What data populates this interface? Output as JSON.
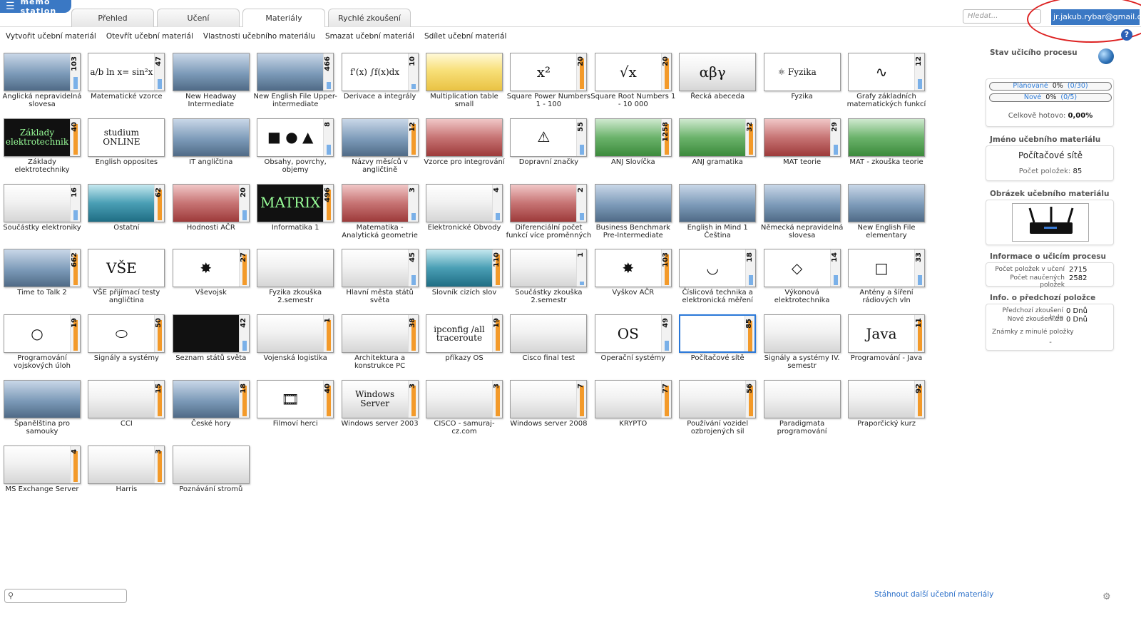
{
  "app": {
    "brand": "memo station",
    "menu_icon": "☰"
  },
  "tabs": [
    "Přehled",
    "Učení",
    "Materiály",
    "Rychlé zkoušení"
  ],
  "active_tab": 2,
  "search": {
    "placeholder": "Hledat..."
  },
  "user": {
    "email": "jr.jakub.rybar@gmail.com"
  },
  "window_controls": "–   ❐   ✕",
  "toolbar": [
    "Vytvořit učební materiál",
    "Otevřít učební materiál",
    "Vlastnosti učebního materiálu",
    "Smazat učební materiál",
    "Sdílet učební materiál"
  ],
  "help": "?",
  "materials": [
    {
      "label": "Anglická nepravidelná slovesa",
      "count": "103",
      "style": "photo",
      "glyph": "",
      "fill": "blue",
      "level": 0.35
    },
    {
      "label": "Matematické vzorce",
      "count": "47",
      "style": "white",
      "glyph": "a/b ln x= sin²x",
      "fill": "blue",
      "level": 0.3
    },
    {
      "label": "New Headway Intermediate",
      "count": "",
      "style": "photo",
      "glyph": "",
      "fill": "",
      "level": 0
    },
    {
      "label": "New English File Upper-intermediate",
      "count": "466",
      "style": "photo",
      "glyph": "",
      "fill": "blue",
      "level": 0.2
    },
    {
      "label": "Derivace a integrály",
      "count": "10",
      "style": "white",
      "glyph": "f'(x) ∫f(x)dx",
      "fill": "blue",
      "level": 0.15
    },
    {
      "label": "Multiplication table small",
      "count": "",
      "style": "yellow",
      "glyph": "",
      "fill": "",
      "level": 0
    },
    {
      "label": "Square Power Numbers 1 - 100",
      "count": "20",
      "style": "white",
      "glyph": "x²",
      "fill": "orange",
      "level": 0.9
    },
    {
      "label": "Square Root Numbers 1 - 10 000",
      "count": "20",
      "style": "white",
      "glyph": "√x",
      "fill": "orange",
      "level": 0.9
    },
    {
      "label": "Řecká abeceda",
      "count": "",
      "style": "gray",
      "glyph": "αβγ",
      "fill": "",
      "level": 0
    },
    {
      "label": "Fyzika",
      "count": "",
      "style": "white",
      "glyph": "⚛ Fyzika",
      "fill": "",
      "level": 0
    },
    {
      "label": "Grafy základních matematických funkcí",
      "count": "12",
      "style": "white",
      "glyph": "∿",
      "fill": "blue",
      "level": 0.3
    },
    {
      "label": "Základy elektrotechniky",
      "count": "40",
      "style": "dark",
      "glyph": "Základy elektrotechnik",
      "fill": "orange",
      "level": 0.9
    },
    {
      "label": "English opposites",
      "count": "",
      "style": "white",
      "glyph": "studium ONLINE",
      "fill": "",
      "level": 0
    },
    {
      "label": "IT angličtina",
      "count": "",
      "style": "photo",
      "glyph": "",
      "fill": "",
      "level": 0
    },
    {
      "label": "Obsahy, povrchy, objemy",
      "count": "8",
      "style": "white",
      "glyph": "■ ● ▲",
      "fill": "blue",
      "level": 0.3
    },
    {
      "label": "Názvy měsíců v angličtině",
      "count": "12",
      "style": "photo",
      "glyph": "",
      "fill": "orange",
      "level": 0.9
    },
    {
      "label": "Vzorce pro integrování",
      "count": "",
      "style": "red",
      "glyph": "",
      "fill": "",
      "level": 0
    },
    {
      "label": "Dopravní značky",
      "count": "55",
      "style": "white",
      "glyph": "⚠",
      "fill": "blue",
      "level": 0.3
    },
    {
      "label": "ANJ Slovíčka",
      "count": "1258",
      "style": "green",
      "glyph": "",
      "fill": "orange",
      "level": 0.9
    },
    {
      "label": "ANJ gramatika",
      "count": "32",
      "style": "green",
      "glyph": "",
      "fill": "orange",
      "level": 0.9
    },
    {
      "label": "MAT teorie",
      "count": "29",
      "style": "red",
      "glyph": "",
      "fill": "blue",
      "level": 0.3
    },
    {
      "label": "MAT - zkouška teorie",
      "count": "",
      "style": "green",
      "glyph": "",
      "fill": "",
      "level": 0
    },
    {
      "label": "Součástky elektroniky",
      "count": "16",
      "style": "gray",
      "glyph": "",
      "fill": "blue",
      "level": 0.3
    },
    {
      "label": "Ostatní",
      "count": "62",
      "style": "teal",
      "glyph": "",
      "fill": "orange",
      "level": 0.9
    },
    {
      "label": "Hodnosti AČR",
      "count": "20",
      "style": "red",
      "glyph": "",
      "fill": "blue",
      "level": 0.3
    },
    {
      "label": "Informatika 1",
      "count": "496",
      "style": "dark",
      "glyph": "MATRIX",
      "fill": "orange",
      "level": 0.9
    },
    {
      "label": "Matematika - Analytická geometrie",
      "count": "3",
      "style": "red",
      "glyph": "",
      "fill": "blue",
      "level": 0.2
    },
    {
      "label": "Elektronické Obvody",
      "count": "4",
      "style": "gray",
      "glyph": "",
      "fill": "blue",
      "level": 0.2
    },
    {
      "label": "Diferenciální počet funkcí více proměnných",
      "count": "2",
      "style": "red",
      "glyph": "",
      "fill": "blue",
      "level": 0.2
    },
    {
      "label": "Business Benchmark Pre-Intermediate",
      "count": "",
      "style": "photo",
      "glyph": "",
      "fill": "",
      "level": 0
    },
    {
      "label": "English in Mind 1 Čeština",
      "count": "",
      "style": "photo",
      "glyph": "",
      "fill": "",
      "level": 0
    },
    {
      "label": "Německá nepravidelná slovesa",
      "count": "",
      "style": "photo",
      "glyph": "",
      "fill": "",
      "level": 0
    },
    {
      "label": "New English File elementary",
      "count": "",
      "style": "photo",
      "glyph": "",
      "fill": "",
      "level": 0
    },
    {
      "label": "Time to Talk 2",
      "count": "662",
      "style": "photo",
      "glyph": "",
      "fill": "orange",
      "level": 0.9
    },
    {
      "label": "VŠE přijímací testy angličtina",
      "count": "",
      "style": "white",
      "glyph": "VŠE",
      "fill": "",
      "level": 0
    },
    {
      "label": "Vševojsk",
      "count": "27",
      "style": "white",
      "glyph": "✸",
      "fill": "orange",
      "level": 0.9
    },
    {
      "label": "Fyzika zkouška 2.semestr",
      "count": "",
      "style": "gray",
      "glyph": "",
      "fill": "",
      "level": 0
    },
    {
      "label": "Hlavní města států světa",
      "count": "45",
      "style": "gray",
      "glyph": "",
      "fill": "blue",
      "level": 0.3
    },
    {
      "label": "Slovník cizích slov",
      "count": "110",
      "style": "teal",
      "glyph": "",
      "fill": "orange",
      "level": 0.9
    },
    {
      "label": "Součástky zkouška 2.semestr",
      "count": "1",
      "style": "gray",
      "glyph": "",
      "fill": "blue",
      "level": 0.1
    },
    {
      "label": "Vyškov AČR",
      "count": "103",
      "style": "white",
      "glyph": "✸",
      "fill": "orange",
      "level": 0.9
    },
    {
      "label": "Číslicová technika a elektronická měření",
      "count": "18",
      "style": "white",
      "glyph": "◡",
      "fill": "blue",
      "level": 0.3
    },
    {
      "label": "Výkonová elektrotechnika",
      "count": "14",
      "style": "white",
      "glyph": "◇",
      "fill": "blue",
      "level": 0.3
    },
    {
      "label": "Antény a šíření rádiových vln",
      "count": "33",
      "style": "white",
      "glyph": "□",
      "fill": "blue",
      "level": 0.3
    },
    {
      "label": "Programování vojskových úloh",
      "count": "19",
      "style": "white",
      "glyph": "○",
      "fill": "orange",
      "level": 0.9
    },
    {
      "label": "Signály a systémy",
      "count": "50",
      "style": "white",
      "glyph": "⬭",
      "fill": "orange",
      "level": 0.9
    },
    {
      "label": "Seznam států světa",
      "count": "42",
      "style": "dark",
      "glyph": "",
      "fill": "blue",
      "level": 0.3
    },
    {
      "label": "Vojenská logistika",
      "count": "1",
      "style": "gray",
      "glyph": "",
      "fill": "orange",
      "level": 0.9
    },
    {
      "label": "Architektura a konstrukce PC",
      "count": "38",
      "style": "gray",
      "glyph": "",
      "fill": "orange",
      "level": 0.9
    },
    {
      "label": "příkazy OS",
      "count": "19",
      "style": "white",
      "glyph": "ipconfig /all traceroute",
      "fill": "orange",
      "level": 0.9
    },
    {
      "label": "Cisco final test",
      "count": "",
      "style": "gray",
      "glyph": "",
      "fill": "",
      "level": 0
    },
    {
      "label": "Operační systémy",
      "count": "49",
      "style": "white",
      "glyph": "OS",
      "fill": "blue",
      "level": 0.3
    },
    {
      "label": "Počítačové sítě",
      "count": "85",
      "style": "white",
      "glyph": "",
      "fill": "orange",
      "level": 0.9
    },
    {
      "label": "Signály a systémy IV. semestr",
      "count": "",
      "style": "gray",
      "glyph": "",
      "fill": "",
      "level": 0
    },
    {
      "label": "Programování - Java",
      "count": "11",
      "style": "white",
      "glyph": "Java",
      "fill": "orange",
      "level": 0.9
    },
    {
      "label": "Španělština pro samouky",
      "count": "",
      "style": "photo",
      "glyph": "",
      "fill": "",
      "level": 0
    },
    {
      "label": "CCI",
      "count": "15",
      "style": "gray",
      "glyph": "",
      "fill": "orange",
      "level": 0.9
    },
    {
      "label": "České hory",
      "count": "18",
      "style": "photo",
      "glyph": "",
      "fill": "orange",
      "level": 0.9
    },
    {
      "label": "Filmoví herci",
      "count": "40",
      "style": "white",
      "glyph": "🎞",
      "fill": "orange",
      "level": 0.9
    },
    {
      "label": "Windows server 2003",
      "count": "3",
      "style": "gray",
      "glyph": "Windows Server",
      "fill": "orange",
      "level": 0.9
    },
    {
      "label": "CISCO - samuraj-cz.com",
      "count": "3",
      "style": "gray",
      "glyph": "",
      "fill": "orange",
      "level": 0.9
    },
    {
      "label": "Windows server 2008",
      "count": "7",
      "style": "gray",
      "glyph": "",
      "fill": "orange",
      "level": 0.9
    },
    {
      "label": "KRYPTO",
      "count": "77",
      "style": "gray",
      "glyph": "",
      "fill": "orange",
      "level": 0.9
    },
    {
      "label": "Používání vozidel ozbrojených sil",
      "count": "56",
      "style": "gray",
      "glyph": "",
      "fill": "orange",
      "level": 0.9
    },
    {
      "label": "Paradigmata programování",
      "count": "",
      "style": "gray",
      "glyph": "",
      "fill": "",
      "level": 0
    },
    {
      "label": "Praporčický kurz",
      "count": "92",
      "style": "gray",
      "glyph": "",
      "fill": "orange",
      "level": 0.9
    },
    {
      "label": "MS Exchange Server",
      "count": "4",
      "style": "gray",
      "glyph": "",
      "fill": "orange",
      "level": 0.9
    },
    {
      "label": "Harris",
      "count": "3",
      "style": "gray",
      "glyph": "",
      "fill": "orange",
      "level": 0.9
    },
    {
      "label": "Poznávání stromů",
      "count": "",
      "style": "gray",
      "glyph": "",
      "fill": "",
      "level": 0
    }
  ],
  "selected_material": 52,
  "sidebar": {
    "process_title": "Stav učicího procesu",
    "planned_label": "Plánované",
    "planned_value": "0%",
    "planned_ratio": "(0/30)",
    "new_label": "Nové",
    "new_value": "0%",
    "new_ratio": "(0/5)",
    "total_label": "Celkově hotovo:",
    "total_value": "0,00%",
    "name_title": "Jméno učebního materiálu",
    "name_value": "Počítačové sítě",
    "items_label": "Počet položek:",
    "items_value": "85",
    "image_title": "Obrázek učebního materiálu",
    "info_title": "Informace o učicím procesu",
    "in_learning_label": "Počet položek v učení",
    "in_learning_value": "2715",
    "learned_label": "Počet naučených položek",
    "learned_value": "2582",
    "prev_title": "Info. o předchozí položce",
    "prev_test_label": "Předchozí zkoušení bylo",
    "prev_test_value": "0 Dnů",
    "next_test_label": "Nové zkoušení za",
    "next_test_value": "0 Dnů",
    "grades_label": "Známky z minulé položky",
    "grades_value": "-"
  },
  "footer": {
    "download_link": "Stáhnout další učební materiály"
  }
}
